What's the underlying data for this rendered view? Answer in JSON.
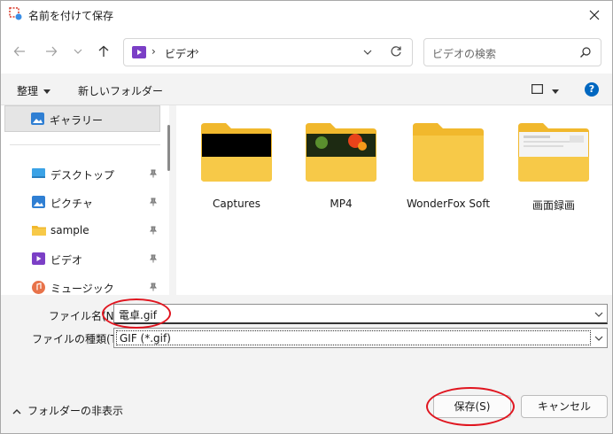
{
  "window": {
    "title": "名前を付けて保存"
  },
  "address": {
    "folder": "ビデオ"
  },
  "search": {
    "placeholder": "ビデオの検索"
  },
  "toolbar": {
    "organize": "整理",
    "new_folder": "新しいフォルダー"
  },
  "sidebar": {
    "selected": "ギャラリー",
    "items": [
      {
        "label": "デスクトップ",
        "icon": "desktop-icon"
      },
      {
        "label": "ピクチャ",
        "icon": "pictures-icon"
      },
      {
        "label": "sample",
        "icon": "folder-icon"
      },
      {
        "label": "ビデオ",
        "icon": "videos-icon"
      },
      {
        "label": "ミュージック",
        "icon": "music-icon"
      }
    ]
  },
  "folders": [
    {
      "label": "Captures"
    },
    {
      "label": "MP4"
    },
    {
      "label": "WonderFox Soft"
    },
    {
      "label": "画面録画"
    }
  ],
  "form": {
    "filename_label": "ファイル名(N):",
    "filename_value": "電卓.gif",
    "filetype_label": "ファイルの種類(T):",
    "filetype_value": "GIF (*.gif)"
  },
  "footer": {
    "hide_folders": "フォルダーの非表示",
    "save": "保存(S)",
    "cancel": "キャンセル"
  },
  "colors": {
    "accent": "#0067c0",
    "highlight": "#e0151f",
    "folder": "#f7c948"
  }
}
